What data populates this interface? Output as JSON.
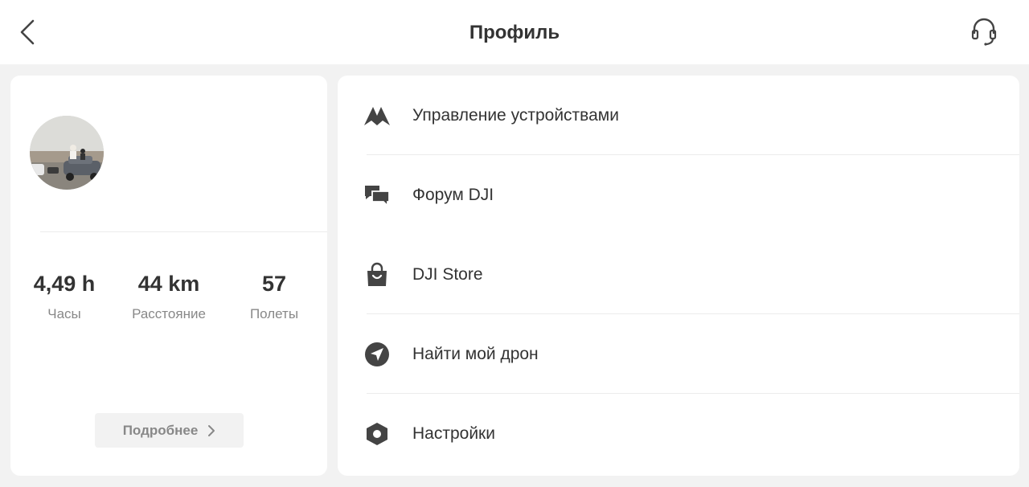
{
  "header": {
    "title": "Профиль",
    "back_icon": "back-arrow-icon",
    "support_icon": "headset-icon"
  },
  "profile": {
    "avatar": "avatar-photo",
    "stats": [
      {
        "value": "4,49 h",
        "label": "Часы"
      },
      {
        "value": "44 km",
        "label": "Расстояние"
      },
      {
        "value": "57",
        "label": "Полеты"
      }
    ],
    "more_button": "Подробнее"
  },
  "menu": {
    "items": [
      {
        "label": "Управление устройствами",
        "icon": "device-management-icon"
      },
      {
        "label": "Форум DJI",
        "icon": "forum-chat-icon"
      },
      {
        "label": "DJI Store",
        "icon": "shopping-bag-icon"
      },
      {
        "label": "Найти мой дрон",
        "icon": "find-drone-compass-icon"
      },
      {
        "label": "Настройки",
        "icon": "settings-hexagon-icon"
      }
    ]
  },
  "colors": {
    "background": "#f2f2f2",
    "card": "#ffffff",
    "text_primary": "#333333",
    "text_secondary": "#888888",
    "icon": "#444444"
  }
}
